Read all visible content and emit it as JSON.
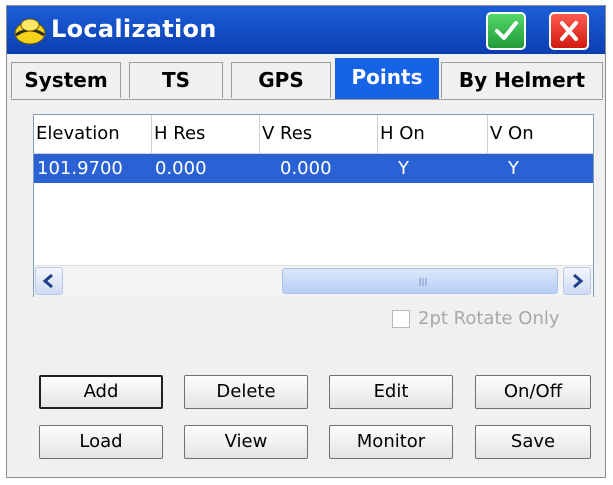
{
  "window": {
    "title": "Localization"
  },
  "tabs": [
    "System",
    "TS",
    "GPS",
    "Points",
    "By Helmert"
  ],
  "active_tab": "Points",
  "table": {
    "columns": [
      "Elevation",
      "H Res",
      "V Res",
      "H On",
      "V On"
    ],
    "rows": [
      [
        "101.9700",
        "0.000",
        "0.000",
        "Y",
        "Y"
      ]
    ]
  },
  "options": {
    "rotate_only_label": "2pt Rotate Only",
    "rotate_only_checked": false
  },
  "buttons": {
    "add": "Add",
    "delete": "Delete",
    "edit": "Edit",
    "on_off": "On/Off",
    "load": "Load",
    "view": "View",
    "monitor": "Monitor",
    "save": "Save"
  },
  "colors": {
    "titlebar": "#0b3fb0",
    "selection": "#2a62d6",
    "ok": "#1f9a37",
    "close": "#d11a12"
  },
  "icons": {
    "app": "helmet-icon",
    "ok": "checkmark-icon",
    "close": "close-icon"
  }
}
